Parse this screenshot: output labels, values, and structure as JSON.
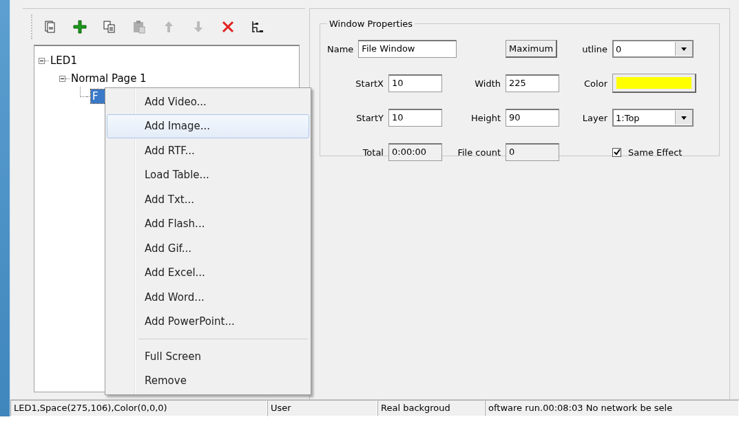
{
  "toolbar": {
    "buttons": [
      {
        "kind": "pages",
        "disabled": false
      },
      {
        "kind": "add",
        "disabled": false
      },
      {
        "kind": "copy",
        "disabled": false
      },
      {
        "kind": "paste",
        "disabled": true
      },
      {
        "kind": "up",
        "disabled": true
      },
      {
        "kind": "down",
        "disabled": true
      },
      {
        "kind": "delete",
        "disabled": false
      },
      {
        "kind": "tree",
        "disabled": false
      }
    ]
  },
  "tree": [
    {
      "label": "LED1",
      "expanded": true,
      "selected": false,
      "children": [
        {
          "label": "Normal Page 1",
          "expanded": true,
          "selected": false,
          "children": [
            {
              "label": "F",
              "selected": true
            }
          ]
        }
      ]
    }
  ],
  "window_properties": {
    "title": "Window Properties",
    "rows": [
      [
        {
          "kind": "field",
          "label": "Name",
          "value": "File Window",
          "disabled": false
        },
        {
          "kind": "button",
          "label": "Maximum"
        },
        {
          "kind": "dropdown",
          "label": "utline",
          "value": "0"
        }
      ],
      [
        {
          "kind": "field",
          "label": "StartX",
          "value": "10",
          "disabled": false
        },
        {
          "kind": "field",
          "label": "Width",
          "value": "225",
          "disabled": false
        },
        {
          "kind": "color",
          "label": "Color",
          "color": "#ffff00"
        }
      ],
      [
        {
          "kind": "field",
          "label": "StartY",
          "value": "10",
          "disabled": false
        },
        {
          "kind": "field",
          "label": "Height",
          "value": "90",
          "disabled": false
        },
        {
          "kind": "dropdown",
          "label": "Layer",
          "value": "1:Top"
        }
      ],
      [
        {
          "kind": "field",
          "label": "Total",
          "value": "0:00:00",
          "disabled": true
        },
        {
          "kind": "field",
          "label": "File count",
          "value": "0",
          "disabled": true
        },
        {
          "kind": "checkbox",
          "label": "Same Effect",
          "checked": true
        }
      ]
    ]
  },
  "context_menu": {
    "items": [
      {
        "kind": "item",
        "label": "Add Video...",
        "selected": false
      },
      {
        "kind": "item",
        "label": "Add Image...",
        "selected": true
      },
      {
        "kind": "item",
        "label": "Add RTF...",
        "selected": false
      },
      {
        "kind": "item",
        "label": "Load Table...",
        "selected": false
      },
      {
        "kind": "item",
        "label": "Add Txt...",
        "selected": false
      },
      {
        "kind": "item",
        "label": "Add Flash...",
        "selected": false
      },
      {
        "kind": "item",
        "label": "Add Gif...",
        "selected": false
      },
      {
        "kind": "item",
        "label": "Add Excel...",
        "selected": false
      },
      {
        "kind": "item",
        "label": "Add Word...",
        "selected": false
      },
      {
        "kind": "item",
        "label": "Add PowerPoint...",
        "selected": false
      },
      {
        "kind": "separator"
      },
      {
        "kind": "item",
        "label": "Full Screen",
        "selected": false
      },
      {
        "kind": "item",
        "label": "Remove",
        "selected": false
      }
    ]
  },
  "status_bar": [
    "LED1,Space(275,106),Color(0,0,0)",
    "User",
    "Real backgroud",
    "oftware run.00:08:03 No network be sele"
  ]
}
